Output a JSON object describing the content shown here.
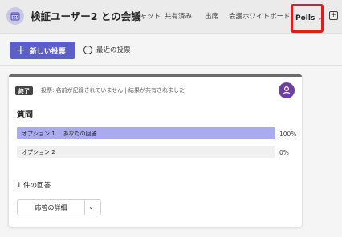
{
  "header": {
    "meeting_title": "検証ユーザー2 との会議",
    "meeting_icon": "calendar-icon",
    "tabs": [
      {
        "label": "チャット"
      },
      {
        "label": "共有済み"
      },
      {
        "label": "出席"
      },
      {
        "label": "会議ホワイトボード"
      }
    ],
    "active_tab": {
      "label": "Polls",
      "icon": "chevron-down-icon"
    },
    "add_tab_icon": "add-tab-icon"
  },
  "toolbar": {
    "new_poll_label": "新しい投票",
    "new_poll_icon": "plus-icon",
    "recent_polls_label": "最近の投票",
    "recent_polls_icon": "history-icon"
  },
  "poll": {
    "status_badge": "終了",
    "status_text": "投票: 名前が記録されていません | 結果が共有されました",
    "avatar_icon": "person-icon",
    "avatar_color": "#6e3fa0",
    "question": "質問",
    "options": [
      {
        "label": "オプション 1",
        "marker": "あなたの回答",
        "percent": "100%",
        "fraction": 1.0
      },
      {
        "label": "オプション 2",
        "marker": "",
        "percent": "0%",
        "fraction": 0.0
      }
    ],
    "response_count": "1 件の回答",
    "details_button_label": "応答の詳細",
    "details_dropdown_icon": "chevron-down-icon"
  },
  "colors": {
    "accent": "#5b5fc7",
    "bar_fill": "#aaaaf0",
    "highlight_border": "#e21b1b"
  }
}
